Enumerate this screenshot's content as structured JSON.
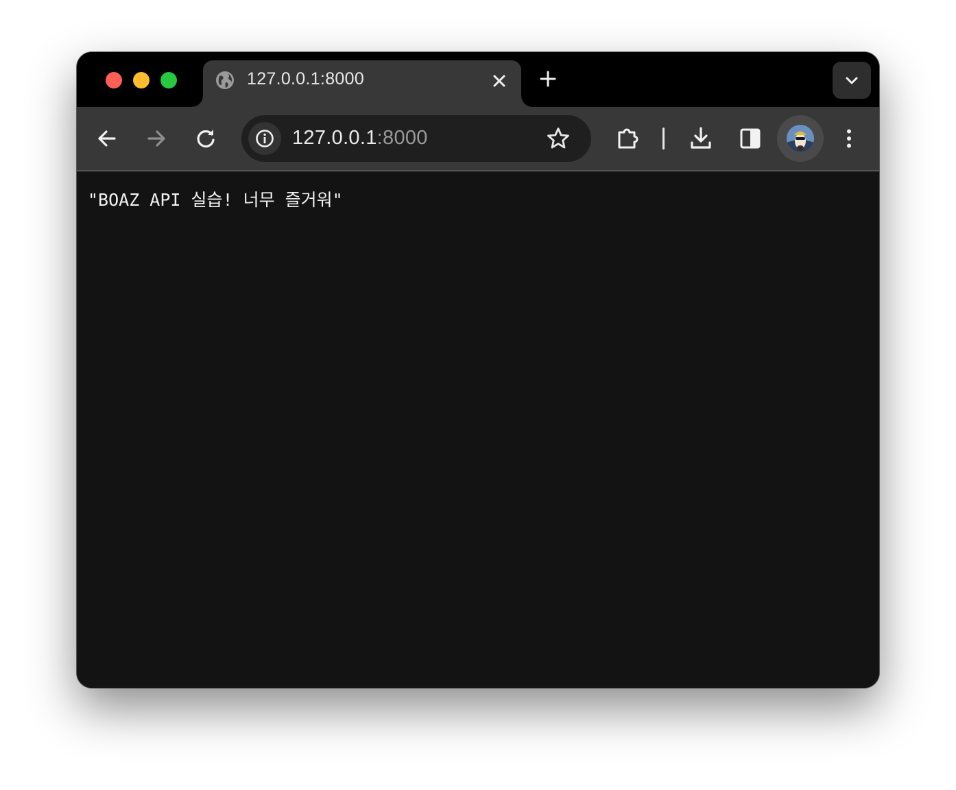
{
  "browser": {
    "tab": {
      "title": "127.0.0.1:8000",
      "favicon": "globe-icon",
      "close_icon": "close-icon"
    },
    "new_tab_icon": "plus-icon",
    "tab_search_icon": "chevron-down-icon",
    "toolbar": {
      "back_icon": "arrow-left-icon",
      "forward_icon": "arrow-right-icon",
      "reload_icon": "reload-icon",
      "extensions_icon": "puzzle-icon",
      "downloads_icon": "download-icon",
      "side_panel_icon": "side-panel-icon",
      "menu_icon": "more-vertical-icon"
    },
    "omnibox": {
      "site_info_icon": "info-icon",
      "url_host": "127.0.0.1",
      "url_port": ":8000",
      "bookmark_icon": "star-icon"
    },
    "profile_icon": "avatar"
  },
  "page": {
    "body_text": "\"BOAZ API 실습! 너무 즐거워\""
  },
  "colors": {
    "traffic_close": "#fe5f57",
    "traffic_minimize": "#febc2e",
    "traffic_maximize": "#28c840",
    "tabstrip_bg": "#000000",
    "toolbar_bg": "#383838",
    "content_bg": "#131313"
  }
}
